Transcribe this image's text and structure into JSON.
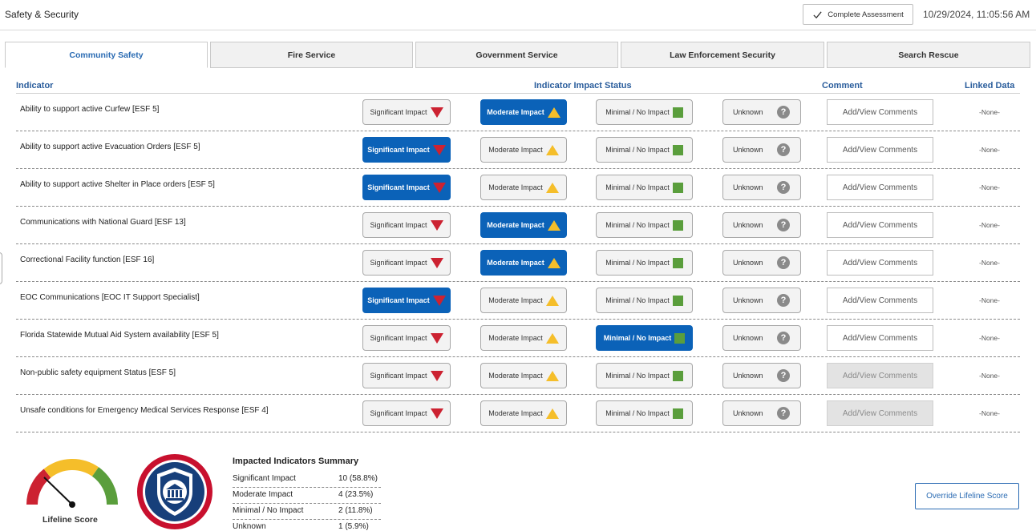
{
  "header": {
    "title": "Safety & Security",
    "complete_label": "Complete Assessment",
    "datetime": "10/29/2024, 11:05:56 AM"
  },
  "tabs": [
    {
      "label": "Community Safety",
      "active": true
    },
    {
      "label": "Fire Service",
      "active": false
    },
    {
      "label": "Government Service",
      "active": false
    },
    {
      "label": "Law Enforcement Security",
      "active": false
    },
    {
      "label": "Search Rescue",
      "active": false
    }
  ],
  "columns": {
    "indicator": "Indicator",
    "status": "Indicator Impact Status",
    "comment": "Comment",
    "linked": "Linked Data"
  },
  "status_labels": {
    "significant": "Significant Impact",
    "moderate": "Moderate Impact",
    "minimal": "Minimal / No Impact",
    "unknown": "Unknown",
    "unknown_icon": "?"
  },
  "comment_label": "Add/View Comments",
  "linked_none": "-None-",
  "colors": {
    "selected": "#0b62b8",
    "significant": "#cc2231",
    "moderate": "#f5be2a",
    "minimal": "#5a9e3c",
    "unknown": "#8a8a8a",
    "accent": "#2a6bb3"
  },
  "indicators": [
    {
      "label": "Ability to support active Curfew [ESF 5]",
      "status": "moderate",
      "comment_enabled": true
    },
    {
      "label": "Ability to support active Evacuation Orders [ESF 5]",
      "status": "significant",
      "comment_enabled": true
    },
    {
      "label": "Ability to support active Shelter in Place orders [ESF 5]",
      "status": "significant",
      "comment_enabled": true
    },
    {
      "label": "Communications with National Guard [ESF 13]",
      "status": "moderate",
      "comment_enabled": true
    },
    {
      "label": "Correctional Facility function [ESF 16]",
      "status": "moderate",
      "comment_enabled": true
    },
    {
      "label": "EOC Communications [EOC IT Support Specialist]",
      "status": "significant",
      "comment_enabled": true
    },
    {
      "label": "Florida Statewide Mutual Aid System availability [ESF 5]",
      "status": "minimal",
      "comment_enabled": true
    },
    {
      "label": "Non-public safety equipment Status [ESF 5]",
      "status": "none",
      "comment_enabled": false
    },
    {
      "label": "Unsafe conditions for Emergency Medical Services Response [ESF 4]",
      "status": "none",
      "comment_enabled": false
    }
  ],
  "lifeline": {
    "label": "Lifeline Score",
    "gauge_icon": "gauge-icon",
    "badge_icon": "police-shield-badge-icon"
  },
  "summary": {
    "title": "Impacted Indicators Summary",
    "rows": [
      {
        "label": "Significant Impact",
        "value": "10 (58.8%)"
      },
      {
        "label": "Moderate Impact",
        "value": "4 (23.5%)"
      },
      {
        "label": "Minimal / No Impact",
        "value": "2 (11.8%)"
      },
      {
        "label": "Unknown",
        "value": "1 (5.9%)"
      }
    ]
  },
  "override_label": "Override Lifeline Score"
}
